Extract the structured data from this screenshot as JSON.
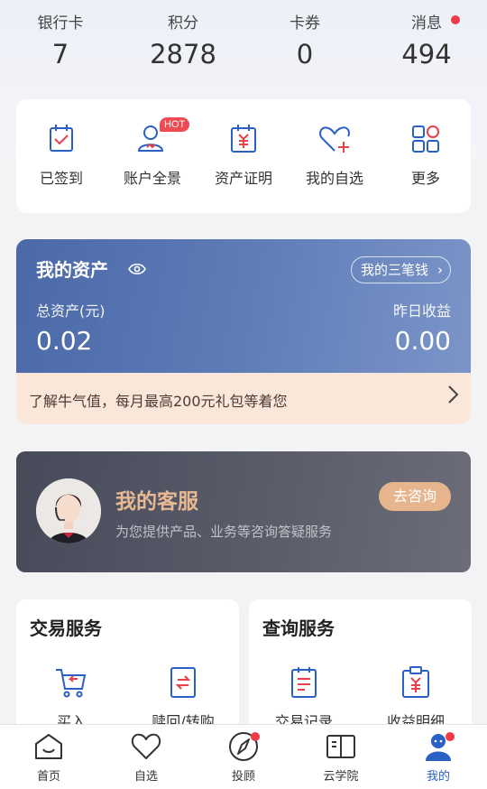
{
  "stats": [
    {
      "label": "银行卡",
      "value": "7"
    },
    {
      "label": "积分",
      "value": "2878"
    },
    {
      "label": "卡券",
      "value": "0"
    },
    {
      "label": "消息",
      "value": "494"
    }
  ],
  "quick": [
    {
      "label": "已签到",
      "icon": "calendar-check-icon"
    },
    {
      "label": "账户全景",
      "icon": "user-icon",
      "badge": "HOT"
    },
    {
      "label": "资产证明",
      "icon": "asset-certificate-icon"
    },
    {
      "label": "我的自选",
      "icon": "heart-plus-icon"
    },
    {
      "label": "更多",
      "icon": "grid-more-icon"
    }
  ],
  "asset": {
    "title": "我的资产",
    "pill": "我的三笔钱",
    "total_label": "总资产(元)",
    "total_value": "0.02",
    "yesterday_label": "昨日收益",
    "yesterday_value": "0.00"
  },
  "promo": {
    "text": "了解牛气值，每月最高200元礼包等着您"
  },
  "service": {
    "title": "我的客服",
    "subtitle": "为您提供产品、业务等咨询答疑服务",
    "button": "去咨询"
  },
  "trade": {
    "title": "交易服务",
    "items": [
      {
        "label": "买入",
        "icon": "cart-icon"
      },
      {
        "label": "赎回/转购",
        "icon": "exchange-icon"
      }
    ]
  },
  "query": {
    "title": "查询服务",
    "items": [
      {
        "label": "交易记录",
        "icon": "record-icon"
      },
      {
        "label": "收益明细",
        "icon": "income-detail-icon"
      }
    ]
  },
  "tabs": [
    {
      "label": "首页",
      "icon": "home-icon"
    },
    {
      "label": "自选",
      "icon": "heart-icon"
    },
    {
      "label": "投顾",
      "icon": "compass-icon"
    },
    {
      "label": "云学院",
      "icon": "book-icon"
    },
    {
      "label": "我的",
      "icon": "profile-icon"
    }
  ],
  "colors": {
    "accent": "#2a5fc4",
    "red": "#ee3b47",
    "asset_bg": "#5f7cb8",
    "gold": "#e6b58d"
  }
}
